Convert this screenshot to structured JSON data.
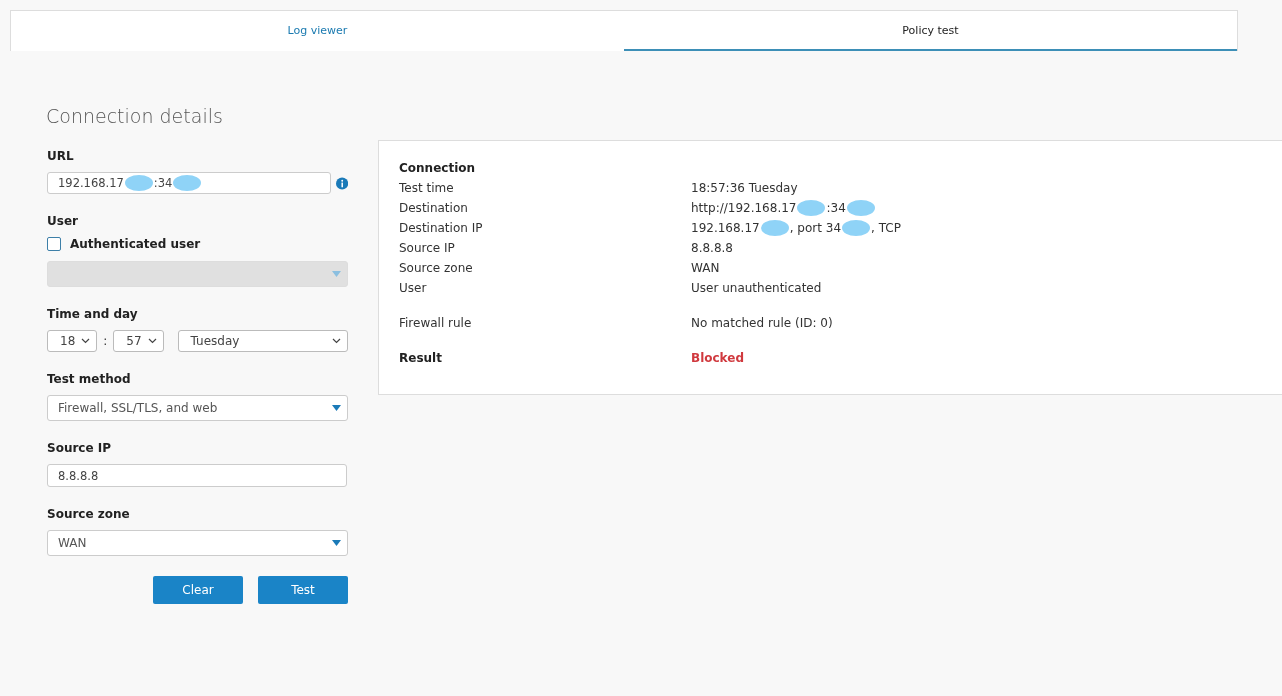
{
  "tabs": [
    {
      "label": "Log viewer",
      "selected": false
    },
    {
      "label": "Policy test",
      "selected": true
    }
  ],
  "form": {
    "title": "Connection details",
    "url": {
      "label": "URL",
      "segments": [
        {
          "text": "192.168.17",
          "masked_after": true
        },
        {
          "text": ":34",
          "masked_after": true
        }
      ]
    },
    "user": {
      "label": "User",
      "checkbox_label": "Authenticated user",
      "checked": false,
      "disabled_select": true
    },
    "time": {
      "label": "Time and day",
      "hour": "18",
      "minute": "57",
      "separator": ":",
      "day": "Tuesday"
    },
    "test_method": {
      "label": "Test method",
      "value": "Firewall, SSL/TLS, and web"
    },
    "source_ip": {
      "label": "Source IP",
      "value": "8.8.8.8"
    },
    "source_zone": {
      "label": "Source zone",
      "value": "WAN"
    },
    "buttons": [
      "Clear",
      "Test"
    ]
  },
  "result": {
    "groups": [
      {
        "rows": [
          {
            "kind": "heading",
            "label": "Connection"
          },
          {
            "kind": "row",
            "label": "Test time",
            "segments": [
              {
                "text": "18:57:36 Tuesday"
              }
            ]
          },
          {
            "kind": "row",
            "label": "Destination",
            "segments": [
              {
                "text": "http://192.168.17",
                "masked_after": true
              },
              {
                "text": ":34",
                "masked_after": true
              }
            ]
          },
          {
            "kind": "row",
            "label": "Destination IP",
            "segments": [
              {
                "text": "192.168.17",
                "masked_after": true
              },
              {
                "text": ", port 34",
                "masked_after": true
              },
              {
                "text": ", TCP"
              }
            ]
          },
          {
            "kind": "row",
            "label": "Source IP",
            "segments": [
              {
                "text": "8.8.8.8"
              }
            ]
          },
          {
            "kind": "row",
            "label": "Source zone",
            "segments": [
              {
                "text": "WAN"
              }
            ]
          },
          {
            "kind": "row",
            "label": "User",
            "segments": [
              {
                "text": "User unauthenticated"
              }
            ]
          }
        ]
      },
      {
        "rows": [
          {
            "kind": "row",
            "label": "Firewall rule",
            "segments": [
              {
                "text": "No matched rule (ID: 0)"
              }
            ]
          }
        ]
      },
      {
        "rows": [
          {
            "kind": "result",
            "label": "Result",
            "segments": [
              {
                "text": "Blocked"
              }
            ]
          }
        ]
      }
    ]
  }
}
